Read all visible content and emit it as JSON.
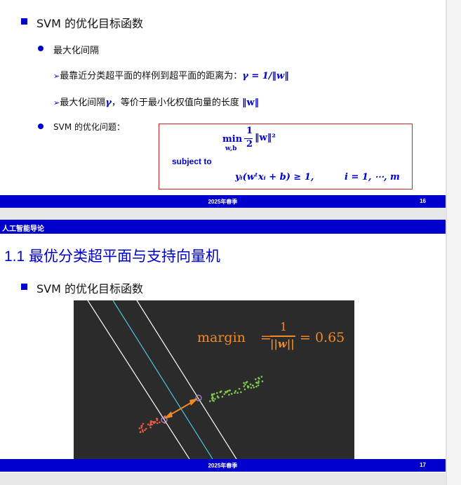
{
  "slide16": {
    "heading": "SVM 的优化目标函数",
    "bullet1": "最大化间隔",
    "sub1_text": "最靠近分类超平面的样例到超平面的距离为：",
    "sub1_math": "γ = 1/‖w‖",
    "sub2_text_a": "最大化间隔",
    "sub2_gamma": "γ",
    "sub2_text_b": "，等价于最小化权值向量的长度",
    "sub2_math": "‖w‖",
    "bullet2": "SVM 的优化问题：",
    "opt_min": "min",
    "opt_sub": "w,b",
    "opt_frac_num": "1",
    "opt_frac_den": "2",
    "opt_norm": "‖w‖²",
    "subject_to": "subject to",
    "constraint": "yᵢ(wᵗxᵢ + b) ≥ 1,",
    "constraint_index": "i = 1, ⋯, m",
    "footer_date": "2025年春季",
    "page_number": "16"
  },
  "slide17": {
    "course_header": "人工智能导论",
    "title": "1.1 最优分类超平面与支持向量机",
    "heading": "SVM 的优化目标函数",
    "figure": {
      "margin_label": "margin",
      "equals": "=",
      "frac_num": "1",
      "frac_den": "||w||",
      "margin_value": "= 0.65"
    },
    "footer_date": "2025年春季",
    "page_number": "17"
  },
  "colors": {
    "accent_blue": "#0000cc",
    "box_red": "#cc2222",
    "figure_bg": "#2b2b2b",
    "hyperplane_cyan": "#4fc3e0",
    "margin_orange": "#f08a24",
    "class_red": "#e05a4a",
    "class_green": "#7ec850"
  }
}
